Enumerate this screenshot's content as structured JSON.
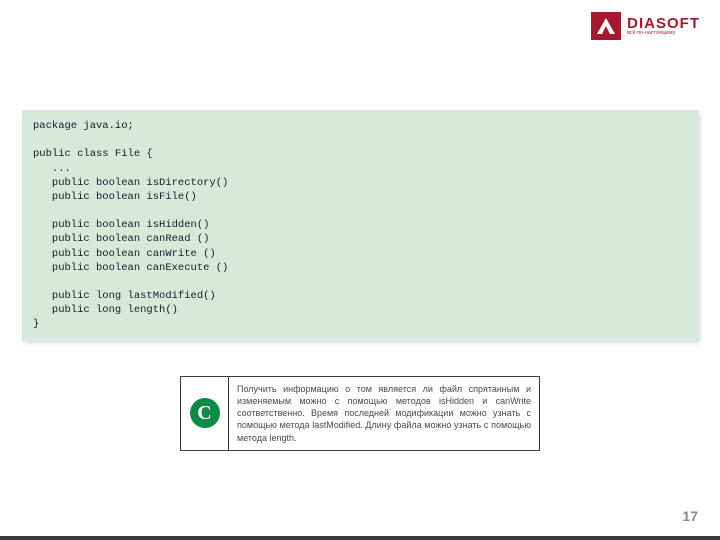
{
  "logo": {
    "brand": "DIASOFT",
    "tagline": "всё по-настоящему"
  },
  "code": {
    "text": "package java.io;\n\npublic class File {\n   ...\n   public boolean isDirectory()\n   public boolean isFile()\n\n   public boolean isHidden()\n   public boolean canRead ()\n   public boolean canWrite ()\n   public boolean canExecute ()\n\n   public long lastModified()\n   public long length()\n}"
  },
  "info": {
    "icon_letter": "C",
    "text": "Получить информацию о том является ли файл спрятанным и изменяемым можно с помощью методов isHidden и canWrite соответственно. Время последней модификации можно узнать с помощью метода lastModified. Длину файла можно узнать с помощью метода length."
  },
  "page_number": "17"
}
